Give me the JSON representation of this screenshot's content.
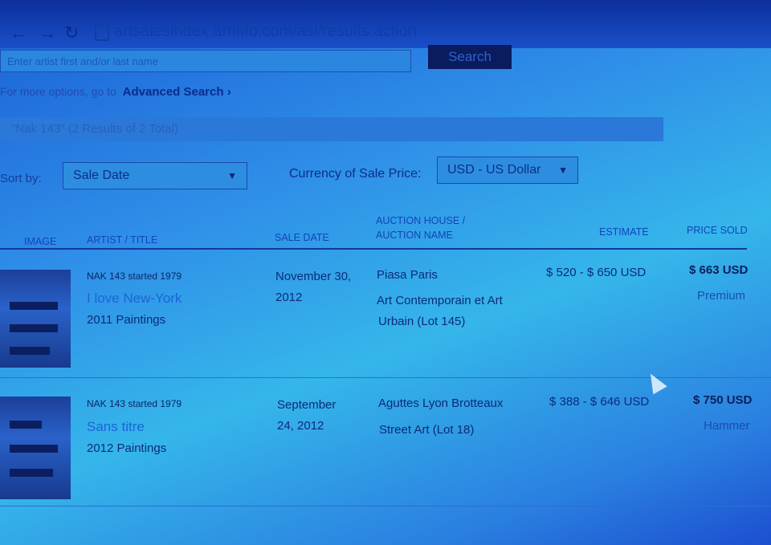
{
  "browser": {
    "url": "artsalesindex.artinfo.com/asi/results.action"
  },
  "search": {
    "placeholder": "Enter artist first and/or last name",
    "button_label": "Search"
  },
  "advanced": {
    "prefix": "For more options, go to",
    "link_label": "Advanced Search ›"
  },
  "results": {
    "query": "\"Nak 143\"",
    "count_text": "(2 Results of 2 Total)"
  },
  "sort": {
    "label": "Sort by:",
    "selected": "Sale Date"
  },
  "currency": {
    "label": "Currency of Sale Price:",
    "selected": "USD - US Dollar"
  },
  "columns": {
    "image": "IMAGE",
    "artist_title": "ARTIST / TITLE",
    "sale_date": "SALE DATE",
    "auction_house_line1": "AUCTION HOUSE /",
    "auction_house_line2": "AUCTION NAME",
    "estimate": "ESTIMATE",
    "price_sold": "PRICE SOLD"
  },
  "rows": [
    {
      "artist": "NAK 143 started 1979",
      "title": "I love New-York",
      "category": "2011 Paintings",
      "date_line1": "November 30,",
      "date_line2": "2012",
      "house": "Piasa Paris",
      "auction_line1": "Art Contemporain et Art",
      "auction_line2": "Urbain (Lot 145)",
      "estimate": "$ 520 - $ 650 USD",
      "price": "$ 663 USD",
      "price_type": "Premium"
    },
    {
      "artist": "NAK 143 started 1979",
      "title": "Sans titre",
      "category": "2012 Paintings",
      "date_line1": "September",
      "date_line2": "24, 2012",
      "house": "Aguttes Lyon Brotteaux",
      "auction_line1": "Street Art (Lot 18)",
      "auction_line2": "",
      "estimate": "$ 388 - $ 646 USD",
      "price": "$ 750 USD",
      "price_type": "Hammer"
    }
  ]
}
